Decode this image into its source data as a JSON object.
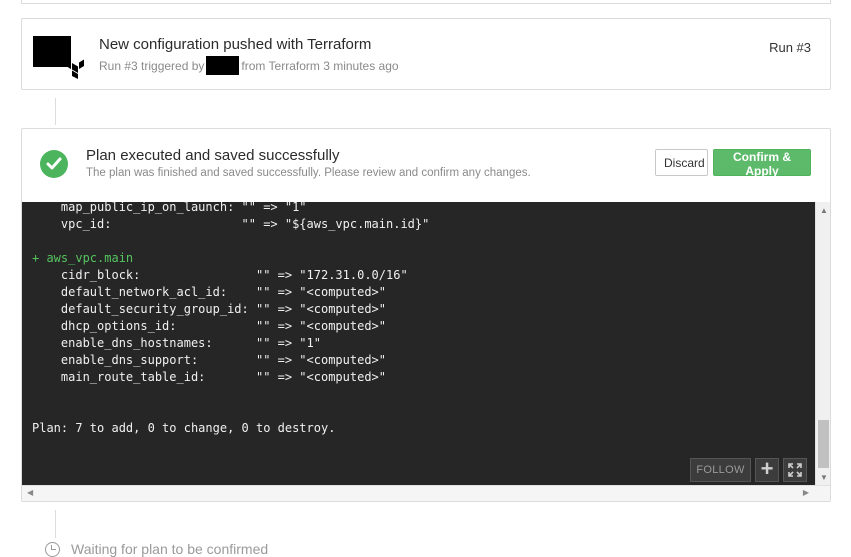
{
  "run": {
    "title": "New configuration pushed with Terraform",
    "subtitle_prefix": "Run #3 triggered by",
    "subtitle_suffix": "from Terraform 3 minutes ago",
    "run_number": "Run #3"
  },
  "plan": {
    "title": "Plan executed and saved successfully",
    "subtitle": "The plan was finished and saved successfully. Please review and confirm any changes.",
    "discard_label": "Discard",
    "apply_label": "Confirm & Apply"
  },
  "terminal": {
    "lines": [
      {
        "text": "    map_public_ip_on_launch: \"\" => \"1\"",
        "color": "default"
      },
      {
        "text": "    vpc_id:                  \"\" => \"${aws_vpc.main.id}\"",
        "color": "default"
      },
      {
        "text": "",
        "color": "default"
      },
      {
        "text": "+ aws_vpc.main",
        "color": "green"
      },
      {
        "text": "    cidr_block:                \"\" => \"172.31.0.0/16\"",
        "color": "default"
      },
      {
        "text": "    default_network_acl_id:    \"\" => \"<computed>\"",
        "color": "default"
      },
      {
        "text": "    default_security_group_id: \"\" => \"<computed>\"",
        "color": "default"
      },
      {
        "text": "    dhcp_options_id:           \"\" => \"<computed>\"",
        "color": "default"
      },
      {
        "text": "    enable_dns_hostnames:      \"\" => \"1\"",
        "color": "default"
      },
      {
        "text": "    enable_dns_support:        \"\" => \"<computed>\"",
        "color": "default"
      },
      {
        "text": "    main_route_table_id:       \"\" => \"<computed>\"",
        "color": "default"
      },
      {
        "text": "",
        "color": "default"
      },
      {
        "text": "",
        "color": "default"
      },
      {
        "text": "Plan: 7 to add, 0 to change, 0 to destroy.",
        "color": "default"
      }
    ],
    "follow_label": "FOLLOW",
    "plus_label": "+"
  },
  "footer": {
    "waiting_text": "Waiting for plan to be confirmed"
  },
  "colors": {
    "success": "#4cb45c",
    "apply_button": "#5cba6a",
    "terminal_bg": "#262626",
    "terminal_green": "#55c35f"
  },
  "icons": {
    "avatar": "redacted-avatar",
    "logo": "terraform-logo-icon",
    "status": "check-circle-icon",
    "expand": "fullscreen-icon",
    "waiting": "clock-icon"
  }
}
